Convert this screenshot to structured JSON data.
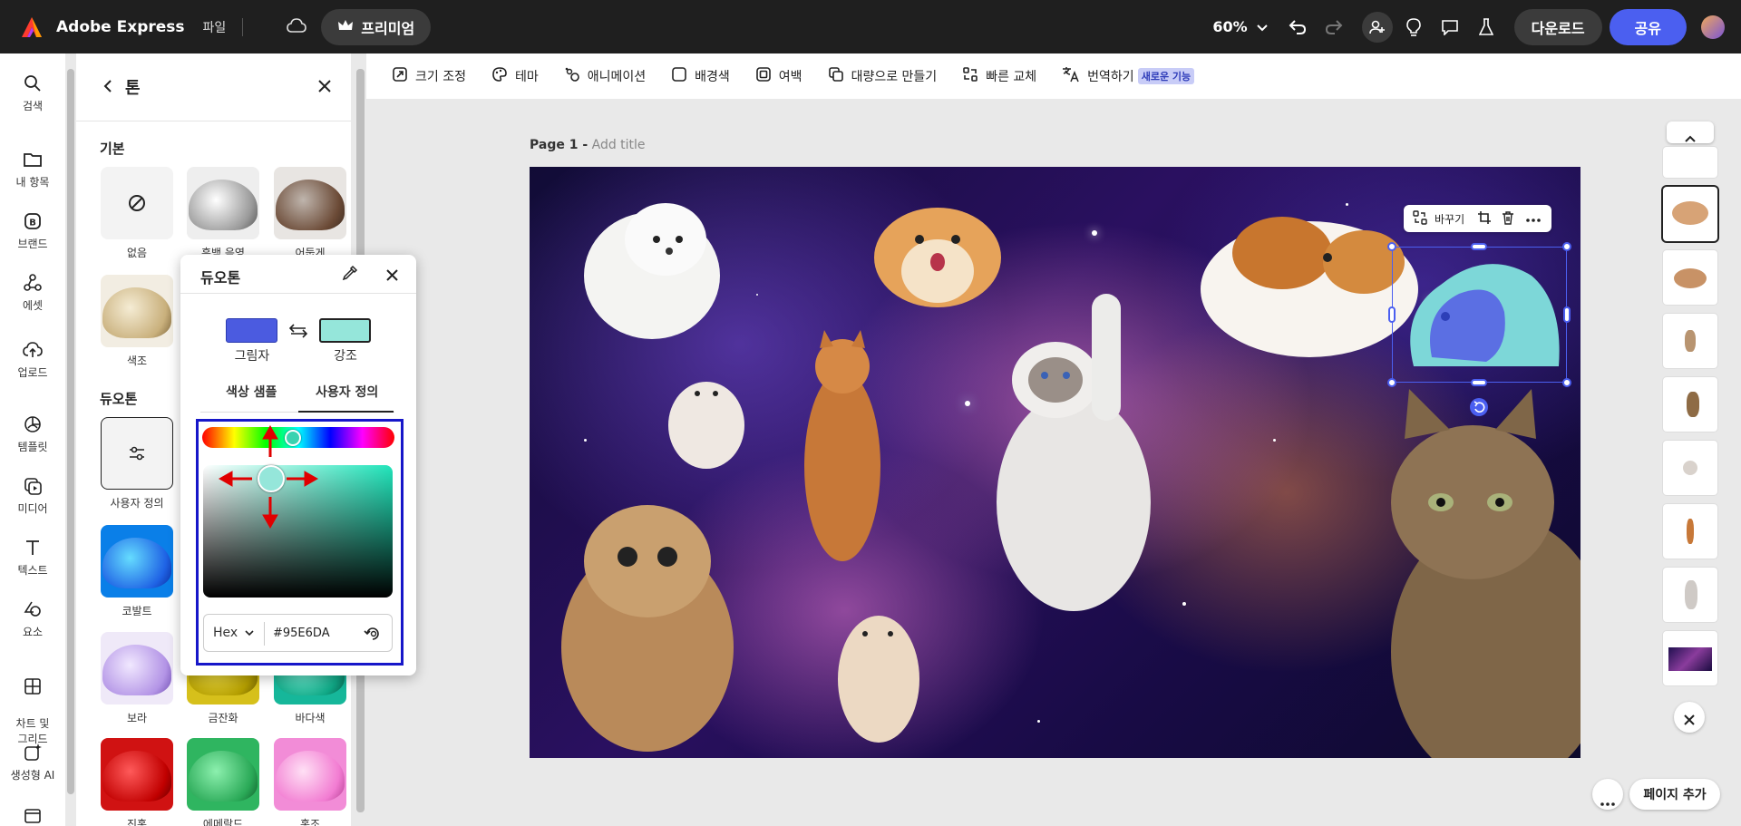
{
  "topbar": {
    "app_name": "Adobe Express",
    "file_menu": "파일",
    "premium_label": "프리미엄",
    "zoom": "60%",
    "download_label": "다운로드",
    "share_label": "공유"
  },
  "rail": {
    "items": [
      {
        "label": "검색",
        "icon": "search-icon"
      },
      {
        "label": "내 항목",
        "icon": "folder-icon"
      },
      {
        "label": "브랜드",
        "icon": "brand-icon"
      },
      {
        "label": "에셋",
        "icon": "assets-icon"
      },
      {
        "label": "업로드",
        "icon": "upload-icon"
      },
      {
        "label": "템플릿",
        "icon": "template-icon"
      },
      {
        "label": "미디어",
        "icon": "media-icon"
      },
      {
        "label": "텍스트",
        "icon": "text-icon"
      },
      {
        "label": "요소",
        "icon": "elements-icon"
      },
      {
        "label": "차트 및\n그리드",
        "icon": "chart-grid-icon"
      },
      {
        "label": "생성형 AI",
        "icon": "generative-ai-icon"
      }
    ]
  },
  "panel": {
    "title": "톤",
    "section_basic": "기본",
    "section_duotone": "듀오톤",
    "basic": [
      {
        "label": "없음"
      },
      {
        "label": "흑백 음영"
      },
      {
        "label": "어둡게"
      },
      {
        "label": "색조"
      }
    ],
    "duotone": [
      {
        "label": "사용자 정의"
      },
      {
        "label": "코발트"
      },
      {
        "label": "보라"
      },
      {
        "label": "금잔화"
      },
      {
        "label": "바다색"
      },
      {
        "label": "진홍"
      },
      {
        "label": "에메랄드"
      },
      {
        "label": "홍조"
      }
    ]
  },
  "duotone_popup": {
    "title": "듀오톤",
    "shadow_label": "그림자",
    "highlight_label": "강조",
    "shadow_color": "#4b5be0",
    "highlight_color": "#95e6da",
    "tab_samples": "색상 샘플",
    "tab_custom": "사용자 정의",
    "format": "Hex",
    "hex_value": "#95E6DA"
  },
  "toolbar": {
    "items": [
      {
        "label": "크기 조정",
        "icon": "resize-icon"
      },
      {
        "label": "테마",
        "icon": "palette-icon"
      },
      {
        "label": "애니메이션",
        "icon": "animation-icon"
      },
      {
        "label": "배경색",
        "icon": "background-color-icon"
      },
      {
        "label": "여백",
        "icon": "margin-icon"
      },
      {
        "label": "대량으로 만들기",
        "icon": "bulk-create-icon"
      },
      {
        "label": "빠른 교체",
        "icon": "quick-swap-icon"
      },
      {
        "label": "번역하기",
        "icon": "translate-icon"
      }
    ],
    "new_badge": "새로운 기능"
  },
  "canvas": {
    "page_label": "Page 1 -",
    "title_placeholder": "Add title",
    "context_replace": "바꾸기"
  },
  "pages_rail": {
    "add_page": "페이지 추가"
  }
}
